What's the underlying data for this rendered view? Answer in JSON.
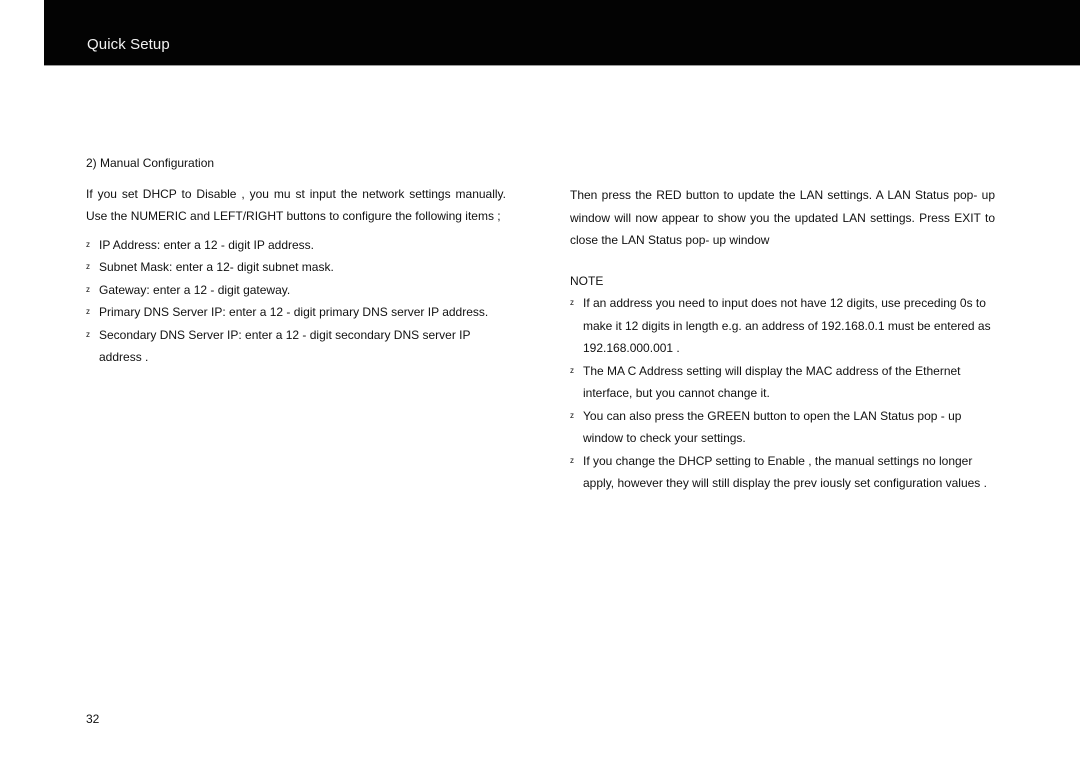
{
  "header": {
    "title": "Quick Setup"
  },
  "left_column": {
    "heading": "2)  Manual Configuration",
    "intro": "If you set  DHCP  to  Disable , you mu        st input  the  network  settings  manually.     Use the   NUMERIC    and  LEFT/RIGHT     buttons  to  configure the following items     ;",
    "bullet_glyph": "z",
    "items": [
      "IP Address: enter a 12      - digit IP address.",
      "Subnet Mask: enter a 12-      digit subnet mask.",
      "Gateway: enter a 12     - digit gateway.",
      "Primary  DNS  Server  IP:      enter  a  12  - digit  primary  DNS  server  IP address.",
      "Secondary DNS Server IP: enter a 12       - digit secondary DNS server IP address ."
    ]
  },
  "right_column": {
    "intro": "Then press the     RED  button to update the LAN settings.            A  LAN Status pop- up window will now appear to show you the updated LAN settings. Press  EXIT   to close the  LAN Status  pop-       up window",
    "note_label": "NOTE",
    "bullet_glyph": "z",
    "notes": [
      "If  an  address  you  need  to  input  does  not  have  12  digits,  use preceding  0s  to  make  it  12  digits  in  length  e.g.  an  address  of   192.168.0.1  must be entered as  192.168.000.001 .",
      "The MA C Address setting     will display the MAC address of the Ethernet interface, but you cannot change it.",
      "You can also press the      GREEN  button to open the  LAN Status  pop        - up window to check your settings.",
      "If  you change the DHCP setting       to  Enable , the manual settings no longer  apply,  however  they  will  still  display           the  prev  iously  set configuration values     ."
    ]
  },
  "footer": {
    "page_number": "32"
  }
}
